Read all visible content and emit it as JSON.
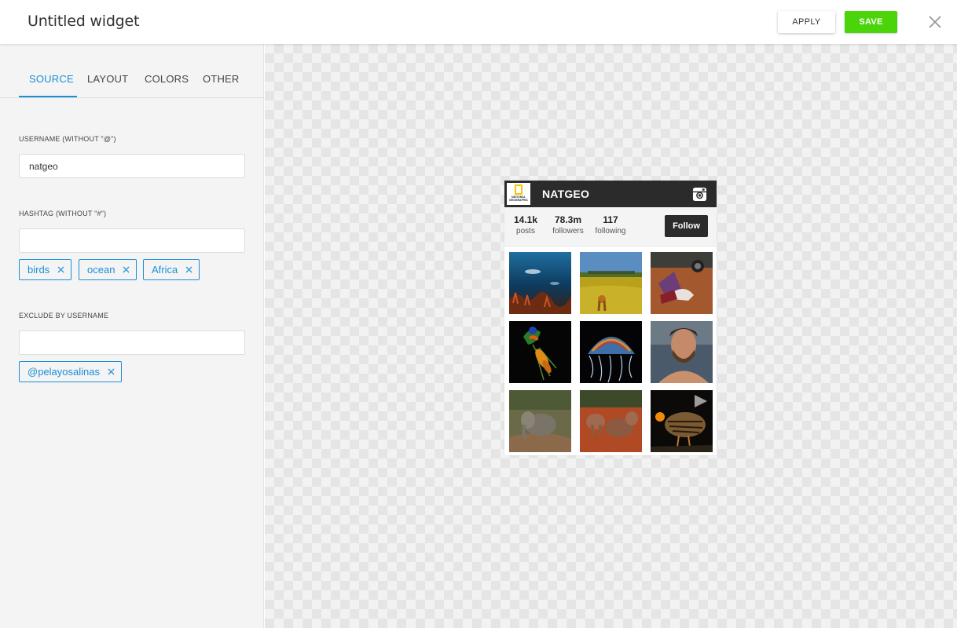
{
  "header": {
    "title": "Untitled widget",
    "apply_label": "APPLY",
    "save_label": "SAVE",
    "save_color": "#4cd40b"
  },
  "tabs": [
    {
      "label": "SOURCE",
      "active": true
    },
    {
      "label": "LAYOUT",
      "active": false
    },
    {
      "label": "COLORS",
      "active": false
    },
    {
      "label": "OTHER",
      "active": false
    }
  ],
  "accent_color": "#1a8fd6",
  "source": {
    "username_label": "USERNAME (WITHOUT \"@\")",
    "username_value": "natgeo",
    "hashtag_label": "HASHTAG (WITHOUT \"#\")",
    "hashtag_value": "",
    "hashtags": [
      "birds",
      "ocean",
      "Africa"
    ],
    "exclude_label": "EXCLUDE BY USERNAME",
    "exclude_value": "",
    "excluded": [
      "@pelayosalinas"
    ]
  },
  "widget": {
    "logo_text": "NATIONAL GEOGRAPHIC",
    "account_name": "NATGEO",
    "stats": [
      {
        "value": "14.1k",
        "label": "posts"
      },
      {
        "value": "78.3m",
        "label": "followers"
      },
      {
        "value": "117",
        "label": "following"
      }
    ],
    "follow_label": "Follow",
    "photos": [
      "underwater-diver",
      "savanna-lion",
      "woman-sleeping",
      "lorikeet-bird",
      "jellyfish",
      "bearded-man",
      "elephant-calf",
      "elephants-group",
      "prairie-chicken-video"
    ]
  }
}
